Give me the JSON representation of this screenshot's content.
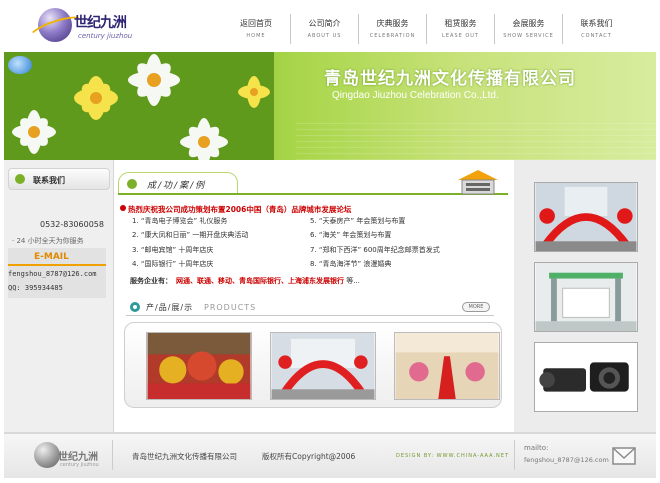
{
  "header": {
    "logo_cn": "世纪九洲",
    "logo_en": "century jiuzhou",
    "nav": [
      {
        "cn": "返回首页",
        "en": "HOME"
      },
      {
        "cn": "公司简介",
        "en": "ABOUT US"
      },
      {
        "cn": "庆典服务",
        "en": "CELEBRATION"
      },
      {
        "cn": "租赁服务",
        "en": "LEASE OUT"
      },
      {
        "cn": "会展服务",
        "en": "SHOW SERVICE"
      },
      {
        "cn": "联系我们",
        "en": "CONTACT"
      }
    ]
  },
  "banner": {
    "title": "青岛世纪九洲文化传播有限公司",
    "subtitle": "Qingdao Jiuzhou Celebration Co.,Ltd."
  },
  "sidebar": {
    "title": "联系我们",
    "phone": "0532-83060058",
    "hours": "· 24 小时全天为你服务",
    "email_title": "E-MAIL",
    "email": "fengshou_8787@126.com",
    "qq": "QQ: 395934485"
  },
  "cases": {
    "title": "成/功/案/例",
    "headline": "热烈庆祝我公司成功策划布置2006中国（青岛）品牌城市发展论坛",
    "items": [
      "1. “青岛电子博览会” 礼仪服务",
      "5. “天泰房产” 年会策划与布置",
      "2. “康大凤和日丽” 一期开盘庆典活动",
      "6. “海关” 年会策划与布置",
      "3. “邮电宾馆” 十周年店庆",
      "7. “郑和下西洋” 600周年纪念邮票首发式",
      "4. “国际银行” 十周年店庆",
      "8. “青岛海洋节” 浪漫婚典"
    ],
    "clients_label": "服务企业有：",
    "clients_value": "网通、联通、移动、青岛国际银行、上海浦东发展银行",
    "clients_more": "等..."
  },
  "products": {
    "title_cn": "产/品/展/示",
    "title_en": "PRODUCTS",
    "more": "MORE"
  },
  "footer": {
    "logo_cn": "世纪九洲",
    "logo_en": "century jiuzhou",
    "company": "青岛世纪九洲文化传播有限公司",
    "copyright": "版权所有Copyright@2006",
    "design": "DESIGN BY: WWW.CHINA-AAA.NET",
    "mailto_label": "mailto:",
    "mail": "fengshou_8787@126.com"
  }
}
